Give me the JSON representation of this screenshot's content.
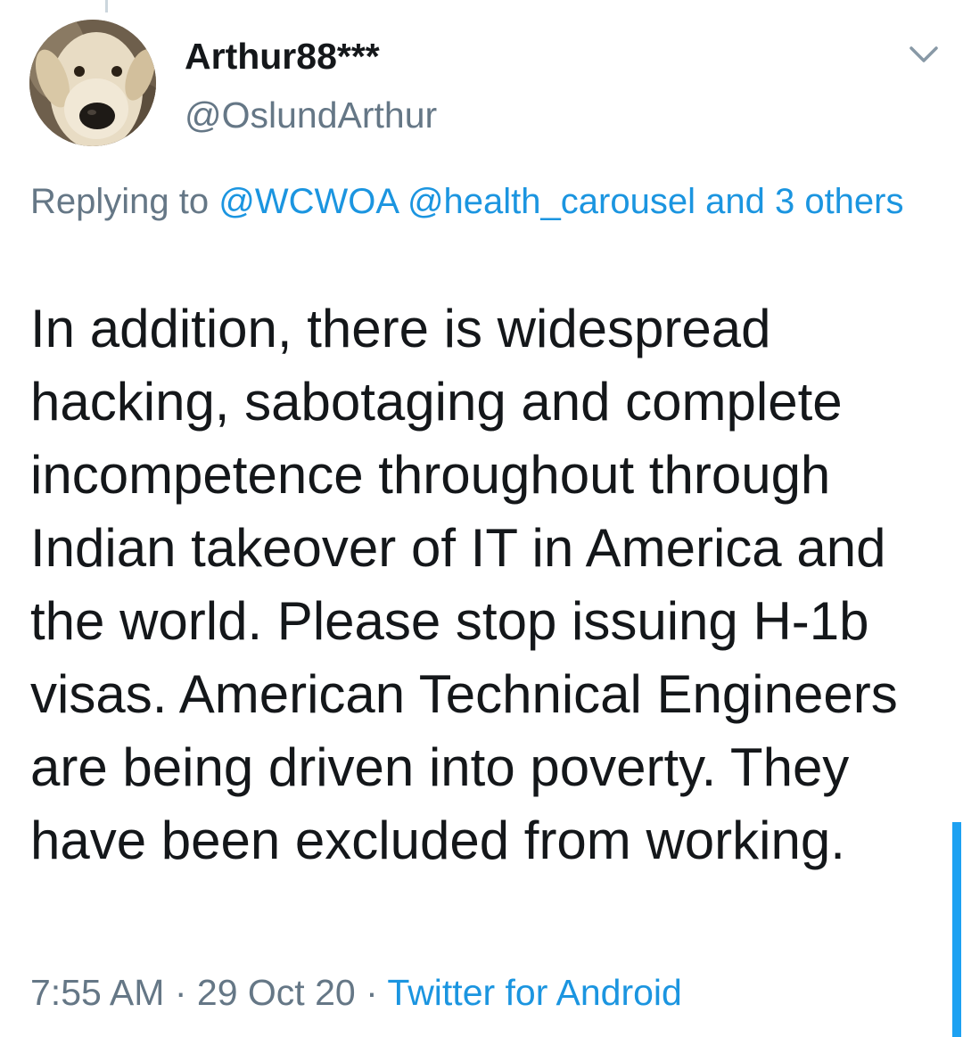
{
  "tweet": {
    "display_name": "Arthur88***",
    "handle": "@OslundArthur",
    "reply": {
      "prefix": "Replying to ",
      "mention_1": "@WCWOA",
      "mention_2": "@health_carousel",
      "others": "and 3 others"
    },
    "text": "In addition, there is widespread hacking, sabotaging and complete incompetence throughout through Indian takeover of IT in America and  the world. Please stop issuing H-1b visas. American Technical Engineers are being driven into poverty. They have been excluded from working.",
    "time": "7:55 AM",
    "date": "29 Oct 20",
    "separator": "·",
    "source": "Twitter for Android"
  },
  "icons": {
    "menu": "chevron-down-icon",
    "avatar": "dog-avatar"
  },
  "colors": {
    "text_primary": "#14171a",
    "text_secondary": "#657786",
    "link": "#1b95e0",
    "scroll_indicator": "#1da1f2"
  }
}
